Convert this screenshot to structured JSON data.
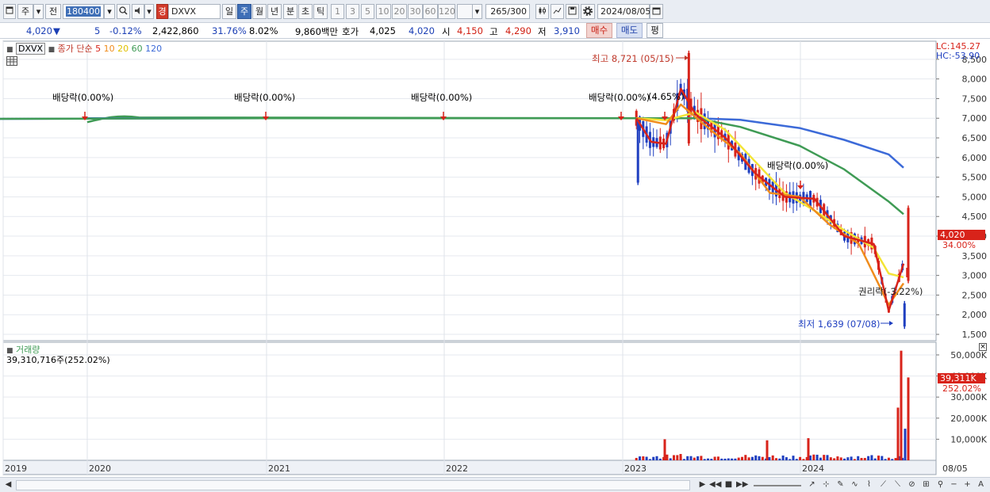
{
  "toolbar": {
    "period_label": "주",
    "prev_label": "전",
    "code_value": "180400",
    "name_badge": "경",
    "name_value": "DXVX",
    "tabs": [
      "일",
      "주",
      "월",
      "년",
      "분",
      "초",
      "틱"
    ],
    "active_tab": "주",
    "intervals": [
      "1",
      "3",
      "5",
      "10",
      "20",
      "30",
      "60",
      "120"
    ],
    "count_value": "265",
    "count_total": "/300",
    "date_value": "2024/08/05"
  },
  "quote": {
    "price": "4,020",
    "change_arrow": "▼",
    "change": "5",
    "change_pct": "-0.12%",
    "volume": "2,422,860",
    "volume_ratio": "31.76%",
    "turnover": "8.02%",
    "amount": "9,860백만",
    "ask_label": "호가",
    "ask": "4,025",
    "bid": "4,020",
    "open_label": "시",
    "open": "4,150",
    "high_label": "고",
    "high": "4,290",
    "low_label": "저",
    "low": "3,910",
    "buy_label": "매수",
    "sell_label": "매도",
    "eval_label": "평"
  },
  "price_pane": {
    "symbol": "DXVX",
    "legend_prefix": "종가 단순",
    "ma_labels": [
      "5",
      "10",
      "20",
      "60",
      "120"
    ],
    "lc_label": "LC:145.27",
    "hc_label": "HC:-53.90",
    "current_price_tag": "4,020",
    "current_pct_tag": "34.00%",
    "high_annotation": "최고 8,721 (05/15)",
    "low_annotation": "최저 1,639 (07/08)",
    "rights_annotation": "권리락(-3.22%)",
    "dividend_labels": [
      "배당락(0.00%)",
      "배당락(0.00%)",
      "배당락(0.00%)",
      "배당락(0.00%)",
      "배당락(0.00%)"
    ],
    "dividend_extra": "(4.65%)"
  },
  "volume_pane": {
    "title": "거래량",
    "summary": "39,310,716주(252.02%)",
    "current_tag": "39,311K",
    "current_pct_tag": "252.02%"
  },
  "colors": {
    "up": "#d8231a",
    "down": "#1f3fc0",
    "ma5": "#d8231a",
    "ma10": "#f08c1c",
    "ma20": "#f3e436",
    "ma60": "#3f9b55",
    "ma120": "#3c6ad8"
  },
  "chart_data": {
    "type": "line",
    "price_axis": {
      "ticks": [
        "1,500",
        "2,000",
        "2,500",
        "3,000",
        "3,500",
        "4,000",
        "4,500",
        "5,000",
        "5,500",
        "6,000",
        "6,500",
        "7,000",
        "7,500",
        "8,000",
        "8,500"
      ],
      "ylim": [
        1400,
        8900
      ]
    },
    "volume_axis": {
      "ticks": [
        "10,000K",
        "20,000K",
        "30,000K",
        "40,000K",
        "50,000K"
      ],
      "ylim": [
        0,
        56000
      ]
    },
    "x_labels": [
      "2019",
      "2020",
      "2021",
      "2022",
      "2023",
      "2024",
      "08/05"
    ],
    "series": [
      {
        "name": "120",
        "x": [
          "2019-01",
          "2020-01",
          "2021-01",
          "2022-01",
          "2023-01",
          "2023-06",
          "2023-09",
          "2024-01",
          "2024-04",
          "2024-07",
          "2024-08"
        ],
        "values": [
          6980,
          6990,
          7000,
          7000,
          7000,
          7000,
          6960,
          6750,
          6450,
          6080,
          5740
        ]
      },
      {
        "name": "60",
        "x": [
          "2019-01",
          "2020-01",
          "2021-01",
          "2022-01",
          "2023-01",
          "2023-06",
          "2023-09",
          "2024-01",
          "2024-04",
          "2024-07",
          "2024-08"
        ],
        "values": [
          6980,
          6990,
          7000,
          7000,
          7000,
          7000,
          6780,
          6300,
          5700,
          4880,
          4560
        ]
      },
      {
        "name": "20",
        "x": [
          "2023-02",
          "2023-04",
          "2023-06",
          "2023-08",
          "2023-10",
          "2023-12",
          "2024-02",
          "2024-04",
          "2024-06",
          "2024-07",
          "2024-08"
        ],
        "values": [
          7000,
          6950,
          7150,
          6700,
          5900,
          5100,
          4650,
          4150,
          3700,
          3050,
          2950
        ]
      },
      {
        "name": "10",
        "x": [
          "2023-02",
          "2023-04",
          "2023-05",
          "2023-07",
          "2023-09",
          "2023-11",
          "2024-01",
          "2024-03",
          "2024-05",
          "2024-07",
          "2024-08"
        ],
        "values": [
          7000,
          6850,
          7350,
          6700,
          6100,
          5100,
          5000,
          4300,
          3800,
          2250,
          2800
        ]
      },
      {
        "name": "5",
        "x": [
          "2023-02",
          "2023-03",
          "2023-04",
          "2023-05",
          "2023-06",
          "2023-08",
          "2023-10",
          "2023-12",
          "2024-02",
          "2024-04",
          "2024-06",
          "2024-07",
          "2024-08"
        ],
        "values": [
          7000,
          6400,
          6350,
          7750,
          7100,
          6500,
          5600,
          5000,
          4950,
          4000,
          3800,
          2100,
          3300
        ]
      }
    ],
    "volume_spikes_k": [
      10000,
      3000,
      9500,
      10500,
      52000,
      25000,
      15000,
      39311
    ]
  }
}
